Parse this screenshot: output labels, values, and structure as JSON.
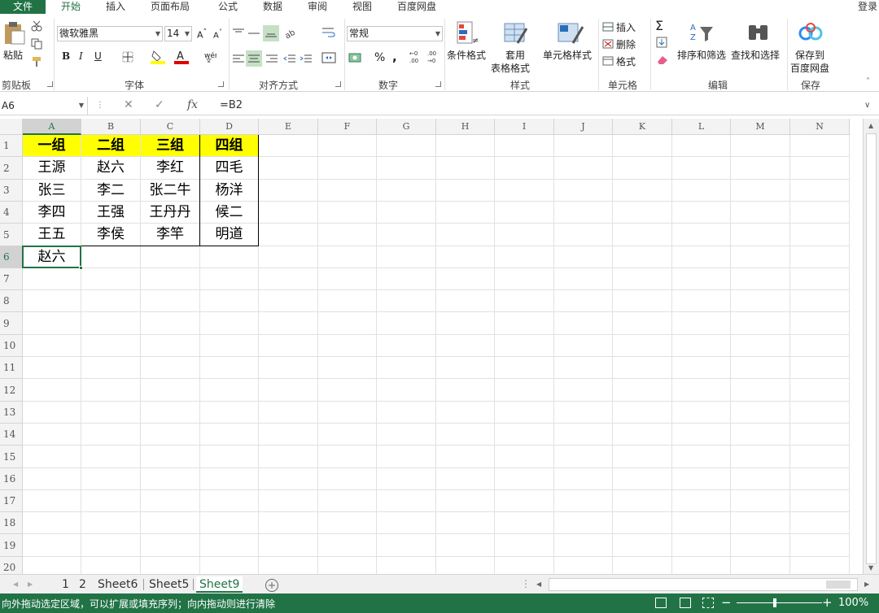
{
  "menu": {
    "file": "文件",
    "tabs": [
      "开始",
      "插入",
      "页面布局",
      "公式",
      "数据",
      "审阅",
      "视图",
      "百度网盘"
    ],
    "active_tab": "开始",
    "login": "登录"
  },
  "ribbon": {
    "clipboard": {
      "paste": "粘贴",
      "label": "剪贴板"
    },
    "font": {
      "name": "微软雅黑",
      "size": "14",
      "bold": "B",
      "italic": "I",
      "underline": "U",
      "label": "字体"
    },
    "alignment": {
      "label": "对齐方式"
    },
    "number": {
      "format": "常规",
      "percent": "%",
      "comma": ",",
      "label": "数字"
    },
    "styles": {
      "conditional": "条件格式",
      "table_l1": "套用",
      "table_l2": "表格格式",
      "cell_style": "单元格样式",
      "label": "样式"
    },
    "cells": {
      "insert": "插入",
      "delete": "删除",
      "format": "格式",
      "label": "单元格"
    },
    "editing": {
      "sort": "排序和筛选",
      "find": "查找和选择",
      "label": "编辑"
    },
    "save": {
      "line1": "保存到",
      "line2": "百度网盘",
      "label": "保存"
    },
    "accent": "#217346"
  },
  "formula_bar": {
    "name_box": "A6",
    "fx": "fx",
    "formula": "=B2"
  },
  "grid": {
    "columns": [
      "A",
      "B",
      "C",
      "D",
      "E",
      "F",
      "G",
      "H",
      "I",
      "J",
      "K",
      "L",
      "M",
      "N"
    ],
    "rows": [
      "1",
      "2",
      "3",
      "4",
      "5",
      "6",
      "7",
      "8",
      "9",
      "10",
      "11",
      "12",
      "13",
      "14",
      "15",
      "16",
      "17",
      "18",
      "19",
      "20"
    ],
    "header_row": [
      "一组",
      "二组",
      "三组",
      "四组"
    ],
    "data": [
      [
        "王源",
        "赵六",
        "李红",
        "四毛"
      ],
      [
        "张三",
        "李二",
        "张二牛",
        "杨洋"
      ],
      [
        "李四",
        "王强",
        "王丹丹",
        "候二"
      ],
      [
        "王五",
        "李侯",
        "李竿",
        "明道"
      ],
      [
        "赵六",
        "",
        "",
        ""
      ]
    ],
    "active_cell": "A6",
    "header_fill": "#ffff00"
  },
  "sheets": {
    "tabs": [
      "1",
      "2",
      "Sheet6",
      "Sheet5",
      "Sheet9"
    ],
    "active": "Sheet9"
  },
  "status": {
    "message": "向外拖动选定区域，可以扩展或填充序列；向内拖动则进行清除",
    "zoom": "100%",
    "zoom_minus": "−",
    "zoom_plus": "+"
  }
}
